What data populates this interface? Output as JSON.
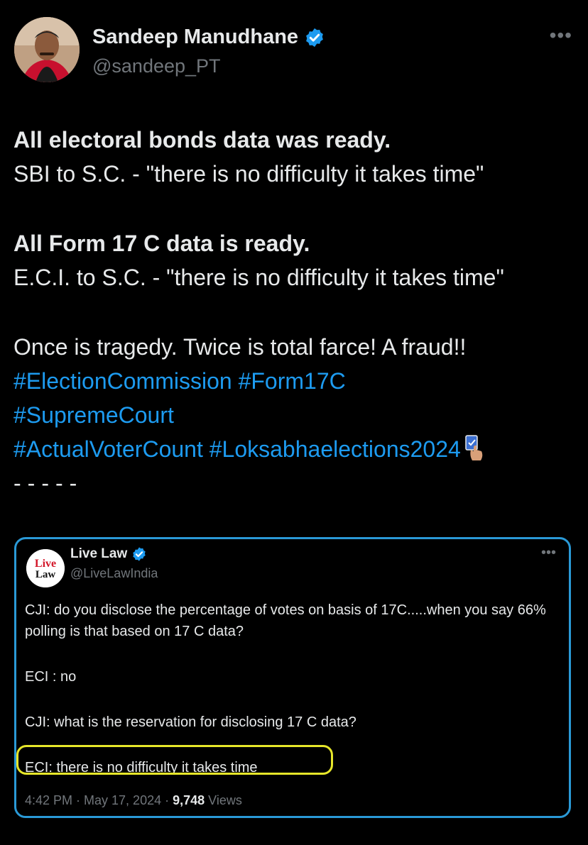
{
  "author": {
    "name": "Sandeep Manudhane",
    "handle": "@sandeep_PT",
    "more_label": "•••"
  },
  "tweet": {
    "line1_bold": "All electoral bonds data was ready.",
    "line2": "SBI to S.C. - \"there is no difficulty it takes time\"",
    "line3_bold": "All Form 17 C data is ready.",
    "line4": "E.C.I. to S.C. - \"there is no difficulty it takes time\"",
    "line5": "Once is tragedy. Twice is total farce! A fraud!!",
    "hashtags": {
      "h1": "#ElectionCommission",
      "h2": "#Form17C",
      "h3": "#SupremeCourt",
      "h4": "#ActualVoterCount",
      "h5": "#Loksabhaelections2024"
    },
    "dashes": "-----"
  },
  "quote": {
    "name": "Live Law",
    "handle": "@LiveLawIndia",
    "logo_top": "Live",
    "logo_bottom": "Law",
    "more_label": "•••",
    "lines": {
      "l1": "CJI: do you disclose the percentage of votes on basis of 17C.....when you say 66% polling is that based on 17 C data?",
      "l2": "ECI : no",
      "l3": "CJI: what is the reservation for disclosing 17 C data?",
      "l4": "ECI: there is no difficulty it takes time"
    },
    "time": "4:42 PM · May 17, 2024 · ",
    "views_count": "9,748",
    "views_label": " Views"
  },
  "colors": {
    "background": "#000000",
    "text": "#e7e9ea",
    "secondary": "#71767b",
    "hashtag": "#1d9bf0",
    "quote_border": "#2a99d6",
    "highlight": "#e6e62a"
  }
}
